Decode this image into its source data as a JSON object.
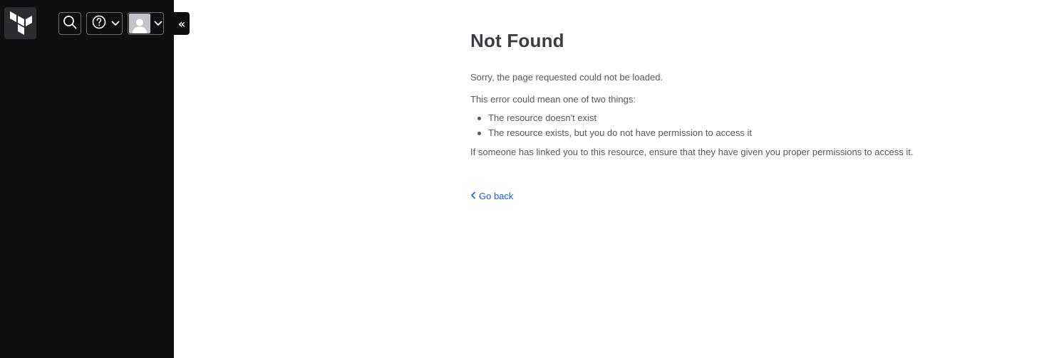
{
  "sidebar": {
    "logo_icon": "terraform-logo-icon",
    "search_icon": "search-icon",
    "help_icon": "help-circle-icon",
    "user_icon": "user-avatar-icon",
    "collapse_label": "«"
  },
  "main": {
    "title": "Not Found",
    "message": "Sorry, the page requested could not be loaded.",
    "intro": "This error could mean one of two things:",
    "reasons": [
      "The resource doesn't exist",
      "The resource exists, but you do not have permission to access it"
    ],
    "advice": "If someone has linked you to this resource, ensure that they have given you proper permissions to access it.",
    "back_label": "Go back"
  },
  "colors": {
    "sidebar_bg": "#0f0f10",
    "link": "#1060ff",
    "heading": "#3b3d45",
    "text": "#555861"
  }
}
